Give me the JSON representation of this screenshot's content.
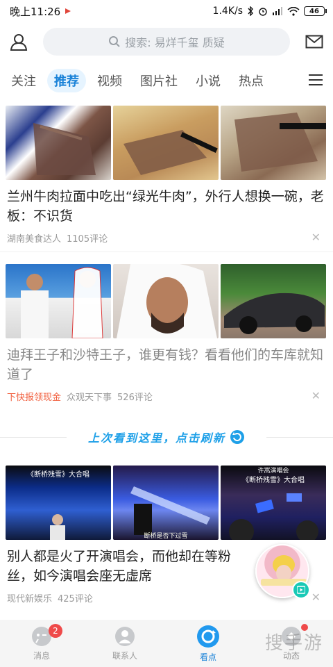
{
  "status": {
    "time": "晚上11:26",
    "speed": "1.4K/s",
    "battery": "46"
  },
  "header": {
    "search_placeholder": "搜索: 易烊千玺 质疑"
  },
  "tabs": [
    "关注",
    "推荐",
    "视频",
    "图片社",
    "小说",
    "热点"
  ],
  "active_tab": "推荐",
  "articles": [
    {
      "title": "兰州牛肉拉面中吃出“绿光牛肉”，外行人想换一碗，老板：不识货",
      "source": "湖南美食达人",
      "comments": "1105评论",
      "read": false
    },
    {
      "title": "迪拜王子和沙特王子，谁更有钱？看看他们的车库就知道了",
      "promo": "下快报领现金",
      "source": "众观天下事",
      "comments": "526评论",
      "read": true
    },
    {
      "title": "别人都是火了开演唱会，而他却在等粉丝，如今演唱会座无虚席",
      "source": "现代新娱乐",
      "comments": "425评论",
      "read": false
    }
  ],
  "refresh": {
    "text": "上次看到这里，点击刷新"
  },
  "image_overlays": {
    "c3a": "《断桥残雪》大合唱",
    "c3b": "断桥是否下过雪",
    "c3c_top": "许嵩演唱会",
    "c3c": "《断桥残雪》大合唱"
  },
  "bottom_nav": [
    {
      "label": "消息",
      "badge": "2"
    },
    {
      "label": "联系人"
    },
    {
      "label": "看点"
    },
    {
      "label": "动态"
    }
  ],
  "watermark": "搜手游",
  "colors": {
    "accent": "#1a82d8",
    "red": "#ef4a4a",
    "refresh": "#1ea0e8"
  }
}
